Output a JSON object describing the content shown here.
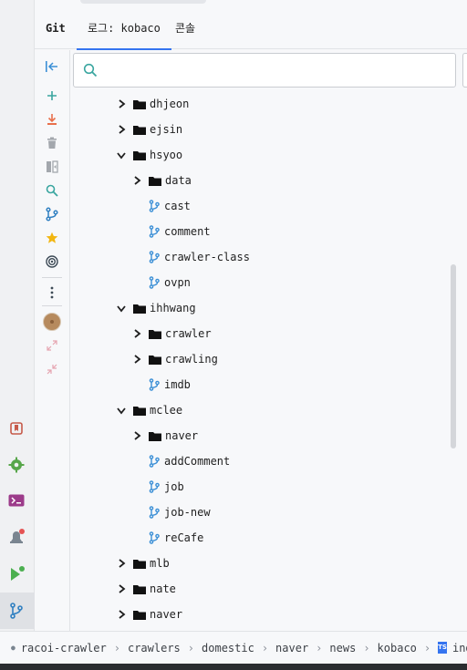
{
  "tabs": {
    "git": "Git",
    "log": "로그: kobaco",
    "console": "콘솔"
  },
  "search": {
    "placeholder": "",
    "value": ""
  },
  "tree": [
    {
      "label": "dhjeon",
      "type": "folder",
      "depth": 0,
      "expanded": false
    },
    {
      "label": "ejsin",
      "type": "folder",
      "depth": 0,
      "expanded": false
    },
    {
      "label": "hsyoo",
      "type": "folder",
      "depth": 0,
      "expanded": true
    },
    {
      "label": "data",
      "type": "folder",
      "depth": 1,
      "expanded": false
    },
    {
      "label": "cast",
      "type": "branch",
      "depth": 1
    },
    {
      "label": "comment",
      "type": "branch",
      "depth": 1
    },
    {
      "label": "crawler-class",
      "type": "branch",
      "depth": 1
    },
    {
      "label": "ovpn",
      "type": "branch",
      "depth": 1
    },
    {
      "label": "ihhwang",
      "type": "folder",
      "depth": 0,
      "expanded": true
    },
    {
      "label": "crawler",
      "type": "folder",
      "depth": 1,
      "expanded": false
    },
    {
      "label": "crawling",
      "type": "folder",
      "depth": 1,
      "expanded": false
    },
    {
      "label": "imdb",
      "type": "branch",
      "depth": 1
    },
    {
      "label": "mclee",
      "type": "folder",
      "depth": 0,
      "expanded": true
    },
    {
      "label": "naver",
      "type": "folder",
      "depth": 1,
      "expanded": false
    },
    {
      "label": "addComment",
      "type": "branch",
      "depth": 1
    },
    {
      "label": "job",
      "type": "branch",
      "depth": 1
    },
    {
      "label": "job-new",
      "type": "branch",
      "depth": 1
    },
    {
      "label": "reCafe",
      "type": "branch",
      "depth": 1
    },
    {
      "label": "mlb",
      "type": "folder",
      "depth": 0,
      "expanded": false
    },
    {
      "label": "nate",
      "type": "folder",
      "depth": 0,
      "expanded": false
    },
    {
      "label": "naver",
      "type": "folder",
      "depth": 0,
      "expanded": false
    }
  ],
  "breadcrumb": [
    "racoi-crawler",
    "crawlers",
    "domestic",
    "naver",
    "news",
    "kobaco"
  ],
  "breadcrumb_file": {
    "badge": "TS",
    "label": "index.conte"
  },
  "toolbar_icons": [
    "collapse-left-icon",
    "plus-icon",
    "download-icon",
    "trash-icon",
    "compare-icon",
    "search-icon",
    "branches-icon",
    "star-icon",
    "target-icon",
    "more-icon",
    "avatar",
    "expand-icon",
    "collapse-icon"
  ],
  "side_icons": [
    "bookmarks-icon",
    "settings-icon",
    "terminal-icon",
    "notifications-icon",
    "run-icon",
    "git-icon"
  ],
  "colors": {
    "accent": "#3574f0",
    "branch": "#3b8fd6",
    "folder": "#111111"
  }
}
